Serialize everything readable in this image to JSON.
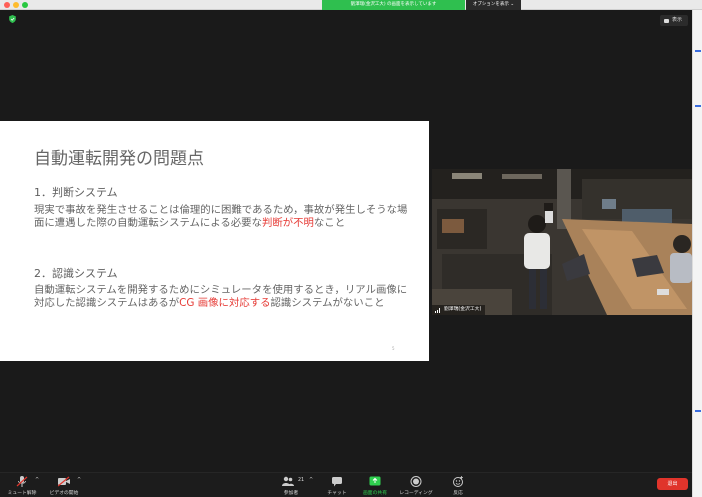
{
  "titlebar": {
    "share_banner": "劉澤瑞(金沢工大) の画面を表示しています",
    "options_label": "オプションを表示 ⌄"
  },
  "topbar": {
    "view_label": "表示"
  },
  "slide": {
    "title": "自動運転開発の問題点",
    "section1_head": "1．判断システム",
    "section1_text": "現実で事故を発生させることは倫理的に困難であるため，事故が発生しそうな場面に遭遇した際の自動運転システムによる必要な",
    "section1_red": "判断が不明",
    "section1_tail": "なこと",
    "section2_head": "2．認識システム",
    "section2_text": "自動運転システムを開発するためにシミュレータを使用するとき，リアル画像に対応した認識システムはあるが",
    "section2_red": "CG 画像に対応する",
    "section2_tail": "認識システムがないこと",
    "page_number": "5"
  },
  "video": {
    "participant_name": "劉澤瑞(金沢工大)"
  },
  "toolbar": {
    "mute_label": "ミュート解除",
    "video_label": "ビデオの開始",
    "participants_label": "参加者",
    "participants_count": "21",
    "chat_label": "チャット",
    "share_label": "画面の共有",
    "record_label": "レコーディング",
    "reactions_label": "反応",
    "end_label": "退出"
  },
  "colors": {
    "accent_green": "#2fbf4f",
    "slide_red": "#e63b36",
    "end_red": "#e0342b"
  }
}
